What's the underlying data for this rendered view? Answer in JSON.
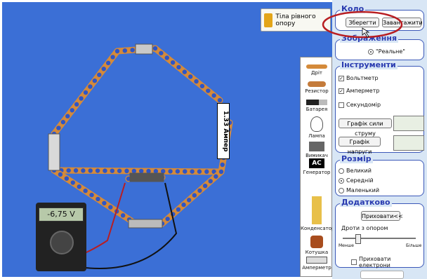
{
  "canvas": {
    "top_badge": {
      "label": "Тіла рівного опору"
    },
    "ammeter_label": "1.33 Ампер",
    "multimeter": {
      "reading": "-6,75 V"
    },
    "toolbox": {
      "items": [
        {
          "label": "Дріт",
          "icon": "wire-icon"
        },
        {
          "label": "Резистор",
          "icon": "resistor-icon"
        },
        {
          "label": "Батарея",
          "icon": "battery-icon"
        },
        {
          "label": "Лампа",
          "icon": "bulb-icon"
        },
        {
          "label": "Вимикач",
          "icon": "switch-icon"
        },
        {
          "label": "Генератор",
          "icon": "ac-generator-icon",
          "icon_text": "AC"
        },
        {
          "label": "Конденсатор",
          "icon": "capacitor-icon"
        },
        {
          "label": "Котушка",
          "icon": "inductor-icon"
        },
        {
          "label": "Амперметр",
          "icon": "ammeter-icon"
        }
      ]
    }
  },
  "panel": {
    "circuit_section": {
      "title": "Коло",
      "save_label": "Зберегти",
      "load_label": "Завантажити"
    },
    "view_section": {
      "title": "Зображення",
      "option": "\"Реальне\""
    },
    "tools_section": {
      "title": "Інструменти",
      "voltmeter": {
        "label": "Вольтметр",
        "checked": true
      },
      "ammeter": {
        "label": "Амперметр",
        "checked": true
      },
      "stopwatch": {
        "label": "Секундомір",
        "checked": false
      },
      "current_graph_label": "Графік сили струму",
      "voltage_graph_label": "Графік напруги"
    },
    "size_section": {
      "title": "Розмір",
      "options": [
        "Великий",
        "Середній",
        "Маленький"
      ],
      "selected": "Середній"
    },
    "extra_section": {
      "title": "Додатково",
      "hide_label": "Приховати<<",
      "slider_title": "Дроти з опором",
      "slider_min": "Менше",
      "slider_max": "Більше",
      "hide_electrons_label": "Приховати електрони"
    }
  },
  "colors": {
    "canvas_bg": "#3b6fd6",
    "wire": "#d48a3a",
    "electron": "#2d55c7",
    "annotation": "#b81e22"
  }
}
